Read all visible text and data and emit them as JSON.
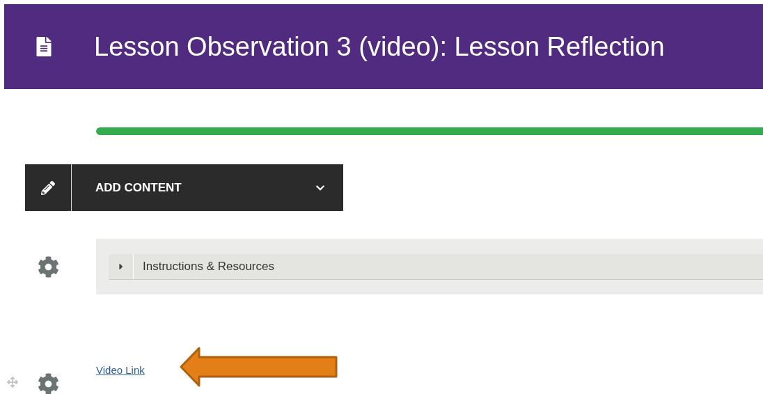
{
  "header": {
    "title": "Lesson Observation 3 (video): Lesson Reflection"
  },
  "progress": {
    "level": 1
  },
  "add_content": {
    "label": "ADD CONTENT"
  },
  "accordion": {
    "title": "Instructions & Resources",
    "expanded": false
  },
  "video_link": {
    "label": "Video Link"
  }
}
